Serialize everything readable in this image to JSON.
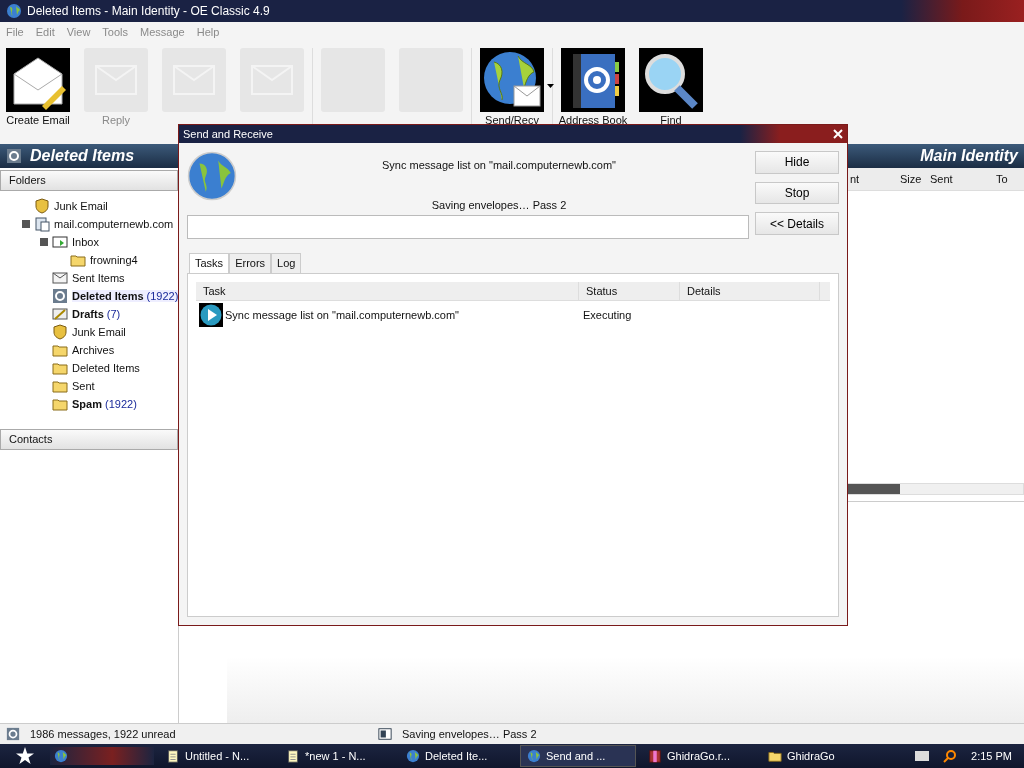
{
  "window": {
    "title": "Deleted Items - Main Identity - OE Classic 4.9"
  },
  "menu": [
    {
      "label": "File",
      "disabled": true
    },
    {
      "label": "Edit",
      "disabled": true
    },
    {
      "label": "View",
      "disabled": true
    },
    {
      "label": "Tools",
      "disabled": true
    },
    {
      "label": "Message",
      "disabled": true
    },
    {
      "label": "Help",
      "disabled": true
    }
  ],
  "toolbar": [
    {
      "kind": "compose",
      "label": "Create Email",
      "disabled": false
    },
    {
      "kind": "mail",
      "label": "Reply",
      "disabled": true
    },
    {
      "kind": "mail",
      "disabled": true
    },
    {
      "kind": "mail",
      "disabled": true,
      "group_end": true
    },
    {
      "kind": "blank",
      "disabled": true
    },
    {
      "kind": "blank",
      "disabled": true,
      "group_end": true
    },
    {
      "kind": "globe",
      "label": "Send/Recv",
      "disabled": false,
      "dropdown": true,
      "group_end": true
    },
    {
      "kind": "book",
      "label": "Address Book",
      "disabled": false
    },
    {
      "kind": "find",
      "label": "Find",
      "disabled": false
    }
  ],
  "folder_header": {
    "title": "Deleted Items",
    "identity": "Main Identity"
  },
  "folders_pane": {
    "title": "Folders"
  },
  "folders": [
    {
      "kind": "junk",
      "label": "Junk Email"
    },
    {
      "kind": "server",
      "label": "mail.computernewb.com",
      "expanded": true,
      "children": [
        {
          "kind": "inbox",
          "label": "Inbox",
          "expanded": true,
          "children": [
            {
              "kind": "folder",
              "label": "frowning4"
            }
          ]
        },
        {
          "kind": "sent",
          "label": "Sent Items"
        },
        {
          "kind": "trash",
          "label": "Deleted Items",
          "count": "(1922)",
          "selected": true
        },
        {
          "kind": "drafts",
          "label": "Drafts",
          "count": "(7)"
        },
        {
          "kind": "junk",
          "label": "Junk Email"
        },
        {
          "kind": "folder",
          "label": "Archives"
        },
        {
          "kind": "folder",
          "label": "Deleted Items"
        },
        {
          "kind": "folder",
          "label": "Sent"
        },
        {
          "kind": "folder",
          "label": "Spam",
          "count": "(1922)"
        }
      ]
    }
  ],
  "contacts_pane": {
    "title": "Contacts"
  },
  "message_list": {
    "columns": [
      {
        "label": "nt"
      },
      {
        "label": "Size"
      },
      {
        "label": "Sent"
      },
      {
        "label": "To"
      }
    ]
  },
  "status_bar": {
    "messages": "1986 messages, 1922 unread",
    "progress": "Saving envelopes… Pass 2"
  },
  "dialog": {
    "title": "Send and Receive",
    "action": "Sync message list on \"mail.computernewb.com\"",
    "progress_text": "Saving envelopes… Pass 2",
    "buttons": [
      "Hide",
      "Stop",
      "<< Details"
    ],
    "tabs": [
      {
        "label": "Tasks",
        "selected": true
      },
      {
        "label": "Errors",
        "selected": false
      },
      {
        "label": "Log",
        "selected": false
      }
    ],
    "columns": [
      "Task",
      "Status",
      "Details"
    ],
    "rows": [
      {
        "task": "Sync message list on \"mail.computernewb.com\"",
        "status": "Executing"
      }
    ]
  },
  "taskbar": {
    "items": [
      {
        "label": "Untitled - N...",
        "kind": "notepad",
        "selected": false
      },
      {
        "label": "*new 1 - N...",
        "kind": "notepad",
        "selected": false
      },
      {
        "label": "Deleted Ite...",
        "kind": "globe",
        "selected": false
      },
      {
        "label": "Send and ...",
        "kind": "globe",
        "selected": true
      },
      {
        "label": "GhidraGo.r...",
        "kind": "archive",
        "selected": false
      },
      {
        "label": "GhidraGo",
        "kind": "folder",
        "selected": false
      }
    ],
    "clock": "2:15 PM"
  }
}
